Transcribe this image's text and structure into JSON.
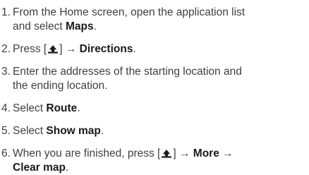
{
  "steps": [
    {
      "num": "1.",
      "line1": "From the Home screen, open the application list",
      "line2_pre": "and select ",
      "line2_bold": "Maps",
      "line2_post": "."
    },
    {
      "num": "2.",
      "pre": "Press [",
      "icon": "menu-key-icon",
      "mid": "] → ",
      "bold": "Directions",
      "post": "."
    },
    {
      "num": "3.",
      "line1": "Enter the addresses of the starting location and",
      "line2": "the ending location."
    },
    {
      "num": "4.",
      "pre": "Select ",
      "bold": "Route",
      "post": "."
    },
    {
      "num": "5.",
      "pre": "Select ",
      "bold": "Show map",
      "post": "."
    },
    {
      "num": "6.",
      "pre": "When you are finished, press [",
      "icon": "menu-key-icon",
      "mid": "] → ",
      "bold1": "More",
      "arrow": " →",
      "line2_bold": "Clear map",
      "line2_post": "."
    }
  ]
}
